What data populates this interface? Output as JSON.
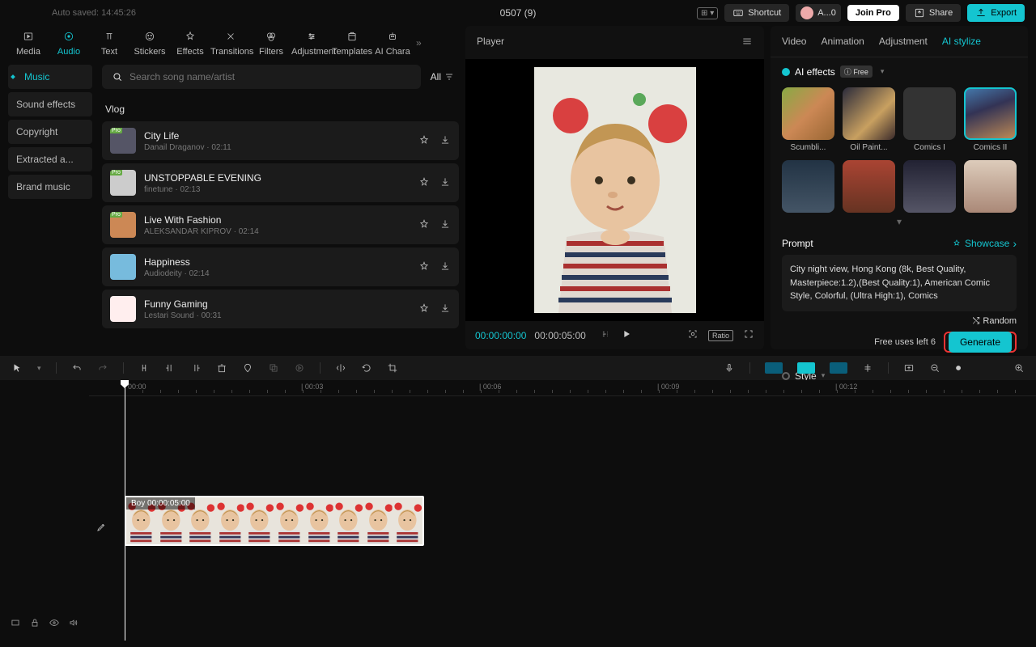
{
  "topbar": {
    "auto_saved": "Auto saved: 14:45:26",
    "title": "0507 (9)",
    "shortcut": "Shortcut",
    "user": "A...0",
    "join": "Join Pro",
    "share": "Share",
    "export": "Export"
  },
  "tabs": [
    "Media",
    "Audio",
    "Text",
    "Stickers",
    "Effects",
    "Transitions",
    "Filters",
    "Adjustment",
    "Templates",
    "AI Chara"
  ],
  "activeTab": 1,
  "categories": [
    "Music",
    "Sound effects",
    "Copyright",
    "Extracted a...",
    "Brand music"
  ],
  "activeCategory": 0,
  "search": {
    "placeholder": "Search song name/artist",
    "all": "All"
  },
  "section": "Vlog",
  "songs": [
    {
      "title": "City Life",
      "meta": "Danail Draganov  ·  02:11",
      "pro": true
    },
    {
      "title": "UNSTOPPABLE EVENING",
      "meta": "finetune  ·  02:13",
      "pro": true
    },
    {
      "title": "Live With Fashion",
      "meta": "ALEKSANDAR KIPROV  ·  02:14",
      "pro": true
    },
    {
      "title": "Happiness",
      "meta": "Audiodeity  ·  02:14",
      "pro": false
    },
    {
      "title": "Funny Gaming",
      "meta": "Lestari Sound  ·  00:31",
      "pro": false
    }
  ],
  "player": {
    "label": "Player",
    "time_a": "00:00:00:00",
    "time_b": "00:00:05:00",
    "ratio": "Ratio"
  },
  "prop_tabs": [
    "Video",
    "Animation",
    "Adjustment",
    "AI stylize"
  ],
  "active_prop_tab": 3,
  "ai": {
    "title": "AI effects",
    "badge": "ⓘ Free",
    "styles": [
      "Scumbli...",
      "Oil Paint...",
      "Comics I",
      "Comics II"
    ],
    "active_style": 3,
    "prompt_label": "Prompt",
    "showcase": "Showcase",
    "prompt_text": "City night view, Hong Kong (8k, Best Quality, Masterpiece:1.2),(Best Quality:1), American Comic Style, Colorful, (Ultra High:1), Comics",
    "random": "Random",
    "free_uses": "Free uses left 6",
    "generate": "Generate",
    "style_label": "Style"
  },
  "ruler_marks": [
    "00:00",
    "| 00:03",
    "| 00:06",
    "| 00:09",
    "| 00:12"
  ],
  "clip": {
    "label": "Boy   00:00:05:00"
  }
}
